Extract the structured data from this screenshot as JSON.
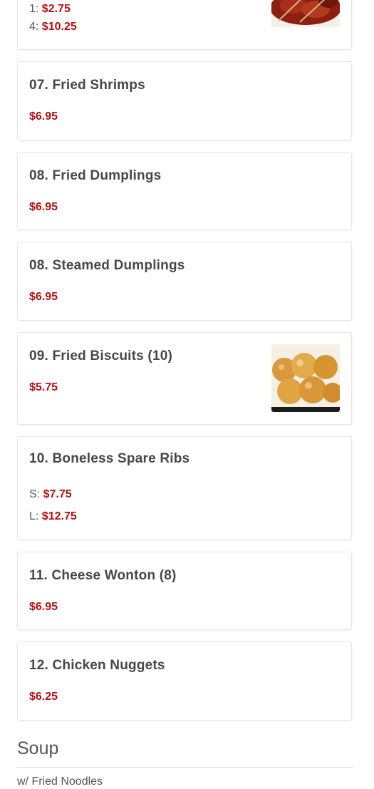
{
  "items": [
    {
      "lines": [
        {
          "label": "1:",
          "price": "$2.75"
        },
        {
          "label": "4:",
          "price": "$10.25"
        }
      ],
      "image": "skewered-meat-photo"
    },
    {
      "title": "07. Fried Shrimps",
      "price": "$6.95"
    },
    {
      "title": "08. Fried Dumplings",
      "price": "$6.95"
    },
    {
      "title": "08. Steamed Dumplings",
      "price": "$6.95"
    },
    {
      "title": "09. Fried Biscuits (10)",
      "price": "$5.75",
      "image": "fried-biscuits-photo"
    },
    {
      "title": "10. Boneless Spare Ribs",
      "lines": [
        {
          "label": "S:",
          "price": "$7.75"
        },
        {
          "label": "L:",
          "price": "$12.75"
        }
      ]
    },
    {
      "title": "11. Cheese Wonton (8)",
      "price": "$6.95"
    },
    {
      "title": "12. Chicken Nuggets",
      "price": "$6.25"
    }
  ],
  "section": {
    "title": "Soup",
    "subtitle": "w/ Fried Noodles"
  },
  "colors": {
    "price": "#b01212",
    "title": "#474747"
  }
}
